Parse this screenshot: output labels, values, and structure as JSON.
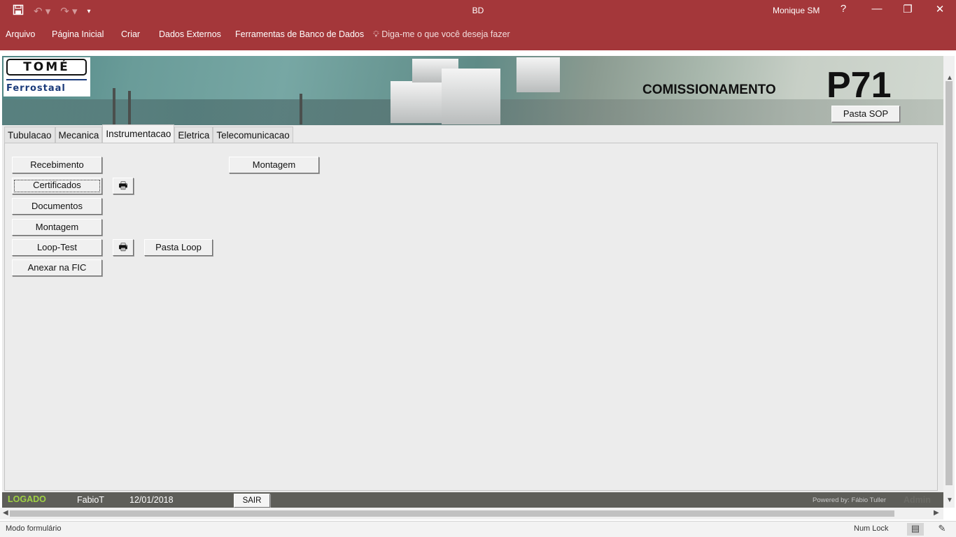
{
  "titlebar": {
    "app_title": "BD",
    "user_name": "Monique SM",
    "help": "?",
    "icons": [
      "save-icon",
      "undo-icon",
      "redo-icon",
      "customize-qat-icon",
      "minimize-icon",
      "restore-icon",
      "close-icon"
    ]
  },
  "menu": {
    "items": [
      "Arquivo",
      "Página Inicial",
      "Criar",
      "Dados Externos",
      "Ferramentas de Banco de Dados"
    ],
    "tell_me": "Diga-me o que você deseja fazer"
  },
  "header": {
    "logo_top": "TOMÉ",
    "logo_bottom": "Ferrostaal",
    "title": "COMISSIONAMENTO",
    "project": "P71",
    "pasta_sop": "Pasta SOP"
  },
  "tabs": [
    "Tubulacao",
    "Mecanica",
    "Instrumentacao",
    "Eletrica",
    "Telecomunicacao"
  ],
  "active_tab": "Instrumentacao",
  "buttons": {
    "recebimento": "Recebimento",
    "certificados": "Certificados",
    "documentos": "Documentos",
    "montagem": "Montagem",
    "loop_test": "Loop-Test",
    "anexar_fic": "Anexar na FIC",
    "pasta_loop": "Pasta Loop",
    "montagem_right": "Montagem",
    "print_icon": "🖶"
  },
  "footer": {
    "logado": "LOGADO",
    "user": "FabioT",
    "date": "12/01/2018",
    "sair": "SAIR",
    "powered_by": "Powered by: Fábio Tuller",
    "admin": "Admin"
  },
  "statusbar": {
    "mode": "Modo formulário",
    "num_lock": "Num Lock"
  },
  "colors": {
    "title_red": "#a4373a",
    "form_bg": "#ebebeb",
    "logado_green": "#9fd143",
    "footer_strip": "#5e5e59"
  }
}
